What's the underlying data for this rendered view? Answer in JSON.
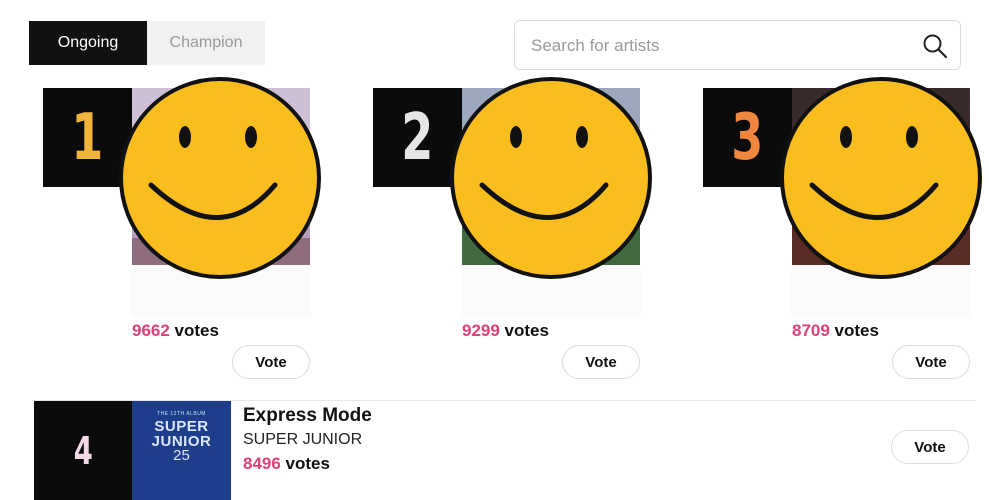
{
  "tabs": [
    {
      "label": "Ongoing",
      "active": true
    },
    {
      "label": "Champion",
      "active": false
    }
  ],
  "search": {
    "placeholder": "Search for artists",
    "icon": "search-icon"
  },
  "top_cards": [
    {
      "rank": "1",
      "rank_color": "#f1b43a",
      "votes": "9662",
      "votes_suffix": " votes",
      "vote_label": "Vote"
    },
    {
      "rank": "2",
      "rank_color": "#e6e6e6",
      "votes": "9299",
      "votes_suffix": " votes",
      "vote_label": "Vote"
    },
    {
      "rank": "3",
      "rank_color": "#f0873f",
      "votes": "8709",
      "votes_suffix": " votes",
      "vote_label": "Vote"
    }
  ],
  "list": [
    {
      "rank": "4",
      "title": "Express Mode",
      "artist": "SUPER JUNIOR",
      "votes": "8496",
      "votes_suffix": " votes",
      "vote_label": "Vote",
      "album_art": {
        "line_top": "THE 12TH ALBUM",
        "line1": "SUPER",
        "line2": "JUNIOR",
        "line3": "25"
      }
    }
  ],
  "colors": {
    "accent": "#e0407a",
    "tab_active_bg": "#111111",
    "rank_bg": "#0b0b0b"
  }
}
